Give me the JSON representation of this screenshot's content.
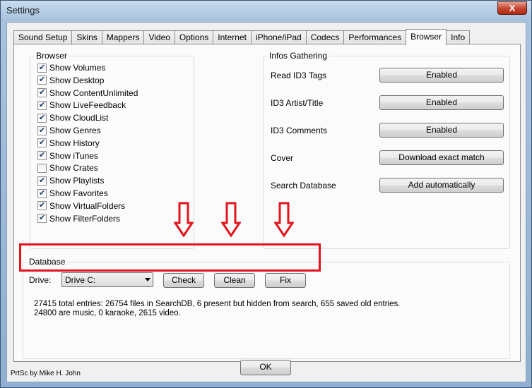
{
  "window": {
    "title": "Settings",
    "close_label": "X"
  },
  "tabs": [
    {
      "label": "Sound Setup"
    },
    {
      "label": "Skins"
    },
    {
      "label": "Mappers"
    },
    {
      "label": "Video"
    },
    {
      "label": "Options"
    },
    {
      "label": "Internet"
    },
    {
      "label": "iPhone/iPad"
    },
    {
      "label": "Codecs"
    },
    {
      "label": "Performances"
    },
    {
      "label": "Browser",
      "active": true
    },
    {
      "label": "Info"
    }
  ],
  "browser": {
    "title": "Browser",
    "items": [
      {
        "label": "Show Volumes",
        "checked": true
      },
      {
        "label": "Show Desktop",
        "checked": true
      },
      {
        "label": "Show ContentUnlimited",
        "checked": true
      },
      {
        "label": "Show LiveFeedback",
        "checked": true
      },
      {
        "label": "Show CloudList",
        "checked": true
      },
      {
        "label": "Show Genres",
        "checked": true
      },
      {
        "label": "Show History",
        "checked": true
      },
      {
        "label": "Show iTunes",
        "checked": true
      },
      {
        "label": "Show Crates",
        "checked": false
      },
      {
        "label": "Show Playlists",
        "checked": true
      },
      {
        "label": "Show Favorites",
        "checked": true
      },
      {
        "label": "Show VirtualFolders",
        "checked": true
      },
      {
        "label": "Show FilterFolders",
        "checked": true
      }
    ]
  },
  "infos": {
    "title": "Infos Gathering",
    "rows": [
      {
        "label": "Read ID3 Tags",
        "value": "Enabled"
      },
      {
        "label": "ID3 Artist/Title",
        "value": "Enabled"
      },
      {
        "label": "ID3 Comments",
        "value": "Enabled"
      },
      {
        "label": "Cover",
        "value": "Download exact match"
      },
      {
        "label": "Search Database",
        "value": "Add automatically"
      }
    ]
  },
  "database": {
    "title": "Database",
    "drive_label": "Drive:",
    "drive_value": "Drive C:",
    "check_label": "Check",
    "clean_label": "Clean",
    "fix_label": "Fix",
    "stats_line1": "27415 total entries: 26754 files in SearchDB, 6 present but hidden from search, 655 saved old entries.",
    "stats_line2": "24800 are music, 0 karaoke, 2615 video."
  },
  "footer": {
    "ok_label": "OK",
    "credit": "PrtSc by Mike H. John"
  },
  "colors": {
    "highlight": "#e3141d",
    "arrow": "#e3141d"
  }
}
